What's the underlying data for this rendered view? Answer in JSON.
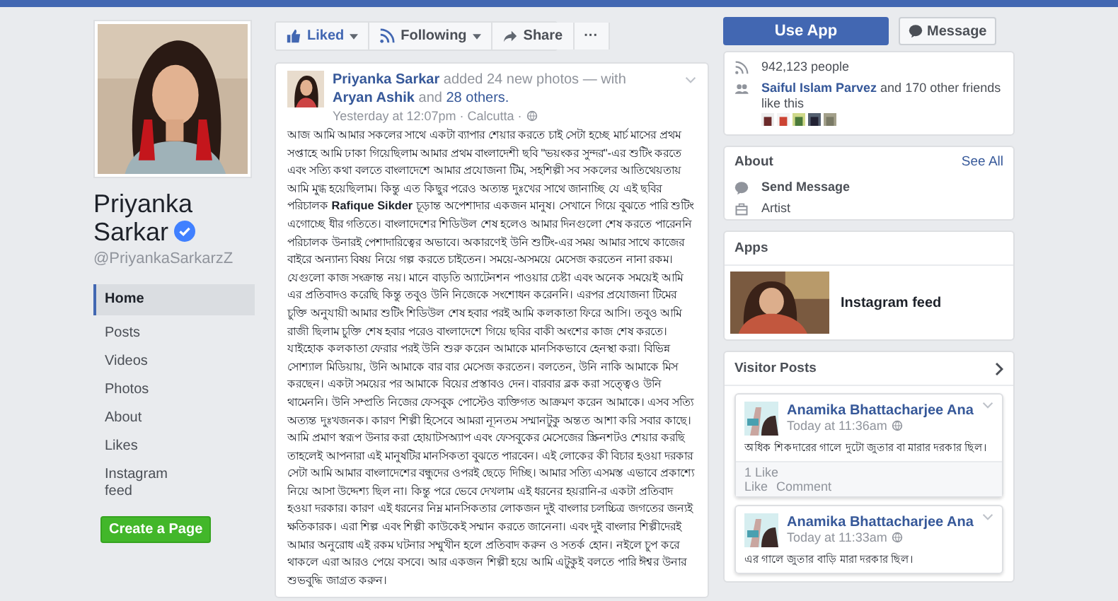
{
  "profile": {
    "name": "Priyanka Sarkar",
    "verified": true,
    "username": "@PriyankaSarkarzZ"
  },
  "sidebar": {
    "items": [
      {
        "label": "Home",
        "selected": true
      },
      {
        "label": "Posts",
        "selected": false
      },
      {
        "label": "Videos",
        "selected": false
      },
      {
        "label": "Photos",
        "selected": false
      },
      {
        "label": "About",
        "selected": false
      },
      {
        "label": "Likes",
        "selected": false
      },
      {
        "label": "Instagram feed",
        "selected": false
      }
    ],
    "create_button": "Create a Page"
  },
  "actions": [
    {
      "label": "Liked",
      "kind": "like"
    },
    {
      "label": "Following",
      "kind": "follow"
    },
    {
      "label": "Share",
      "kind": "share"
    },
    {
      "label": "···",
      "kind": "more"
    }
  ],
  "post": {
    "author": "Priyanka Sarkar",
    "action": "added 24 new photos — with",
    "tagged": "Aryan Ashik",
    "joiner": "and",
    "others": "28 others.",
    "time": "Yesterday at 12:07pm · Calcutta ·",
    "body": "আজ আমি আমার সকলের সাথে একটা ব্যাপার শেয়ার করতে চাই সেটা হচ্ছে মার্চ মাসের প্রথম সপ্তাহে আমি ঢাকা গিয়েছিলাম আমার প্রথম বাংলাদেশী ছবি \"ভয়ংকর সুন্দর\"-এর শুটিং করতে এবং সত্যি কথা বলতে বাংলাদেশে আমার প্রযোজনা টিম, সহশিল্পী সব সকলের আতিথেয়তায় আমি মুগ্ধ হয়েছিলাম। কিন্তু এত কিছুর পরেও অত্যন্ত দুঃখের সাথে জানাচ্ছি যে এই ছবির পরিচালক **Rafique Sikder** চূড়ান্ত অপেশাদার একজন মানুষ। সেখানে গিয়ে বুঝতে পারি শুটিং এগোচ্ছে ধীর গতিতে। বাংলাদেশের শিডিউল শেষ হলেও আমার দিনগুলো শেষ করতে পারেননি পরিচালক উনারই পেশাদারিত্বের অভাবে। অকারণেই উনি শুটিং-এর সময় আমার সাথে কাজের বাইরে অন্যান্য বিষয় নিয়ে গল্প করতে চাইতেন। সময়ে-অসময়ে মেসেজ করতেন নানা রকম। যেগুলো কাজ সংক্রান্ত নয়। মানে বাড়তি অ্যাটেনশন পাওয়ার চেষ্টা এবং অনেক সময়েই আমি এর প্রতিবাদও করেছি কিন্তু তবুও উনি নিজেকে সংশোধন করেননি। এরপর প্রযোজনা টিমের চুক্তি অনুযায়ী আমার শুটিং শিডিউল শেষ হবার পরই আমি কলকাতা ফিরে আসি। তবুও আমি রাজী ছিলাম চুক্তি শেষ হবার পরেও বাংলাদেশে গিয়ে ছবির বাকী অংশের কাজ শেষ করতে। যাইহোক কলকাতা ফেরার পরই উনি শুরু করেন আমাকে মানসিকভাবে হেনস্থা করা। বিভিন্ন সোশ্যাল মিডিয়ায়, উনি আমাকে বার বার মেসেজ করতেন। বলতেন, উনি নাকি আমাকে মিস করছেন। একটা সময়ের পর আমাকে বিয়ের প্রস্তাবও দেন। বারবার ব্লক করা সত্ত্বেও উনি থামেননি। উনি সম্প্রতি নিজের ফেসবুক পোস্টেও ব্যক্তিগত আক্রমণ করেন আমাকে। এসব সত্যি অত্যন্ত দুঃখজনক। কারণ শিল্পী হিসেবে আমরা ন্যূনতম সম্মানটুকু অন্তত আশা করি সবার কাছে। আমি প্রমাণ স্বরূপ উনার করা হোয়াটসঅ্যাপ এবং ফেসবুকের মেসেজের স্ক্রিনশটও শেয়ার করছি তাহলেই আপনারা এই মানুষটির মানসিকতা বুঝতে পারবেন। এই লোকের কী বিচার হওয়া দরকার সেটা আমি আমার বাংলাদেশের বন্ধুদের ওপরই ছেড়ে দিচ্ছি। আমার সত্যি এসমস্ত এভাবে প্রকাশ্যে নিয়ে আসা উদ্দেশ্য ছিল না। কিন্তু পরে ভেবে দেখলাম এই ধরনের হয়রানি-র একটা প্রতিবাদ হওয়া দরকার। কারণ এই ধরনের নিম্ন মানসিকতার লোকজন দুই বাংলার চলচ্চিত্র জগতের জন্যই ক্ষতিকারক। এরা শিল্প এবং শিল্পী কাউকেই সম্মান করতে জানেনা। এবং দুই বাংলার শিল্পীদেরই আমার অনুরোধ এই রকম ঘটনার সম্মুখীন হলে প্রতিবাদ করুন ও সতর্ক হোন। নইলে চুপ করে থাকলে এরা আরও পেয়ে বসবে। আর একজন শিল্পী হয়ে আমি এটুকুই বলতে পারি ঈশ্বর উনার শুভবুদ্ধি জাগ্রত করুন।"
  },
  "top_buttons": {
    "primary": "Use App",
    "secondary": "Message"
  },
  "community": {
    "followers": "942,123 people",
    "friend": "Saiful Islam Parvez",
    "friends_text": "and 170 other friends like this"
  },
  "about": {
    "title": "About",
    "see_all": "See All",
    "items": [
      {
        "label": "Send Message",
        "kind": "message"
      },
      {
        "label": "Artist",
        "kind": "category"
      }
    ]
  },
  "apps": {
    "title": "Apps",
    "items": [
      {
        "label": "Instagram feed"
      }
    ]
  },
  "visitor_posts": {
    "title": "Visitor Posts",
    "posts": [
      {
        "author": "Anamika Bhattacharjee Ana",
        "time": "Today at 11:36am",
        "text": "অধিক শিকদারের গালে দুটো জুতার বা মারার দরকার ছিল।",
        "likes": "1 Like",
        "actions": [
          "Like",
          "Comment"
        ]
      },
      {
        "author": "Anamika Bhattacharjee Ana",
        "time": "Today at 11:33am",
        "text": "এর গালে জুতার বাড়ি মারা দরকার ছিল।"
      }
    ]
  }
}
